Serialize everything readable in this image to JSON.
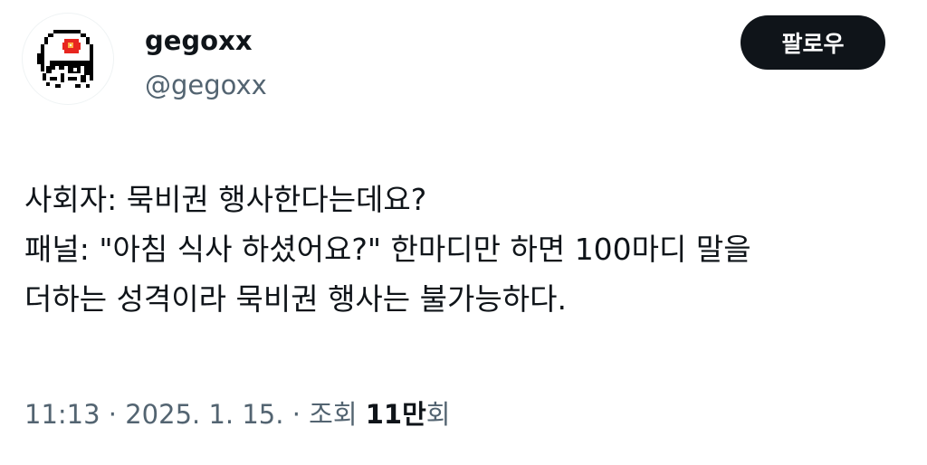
{
  "user": {
    "display_name": "gegoxx",
    "handle": "@gegoxx",
    "avatar_icon": "pixel-ghost-avatar"
  },
  "follow_button": {
    "label": "팔로우"
  },
  "tweet": {
    "lines": [
      "사회자: 묵비권 행사한다는데요?",
      "패널: \"아침 식사 하셨어요?\" 한마디만 하면 100마디 말을",
      "더하는 성격이라 묵비권 행사는 불가능하다."
    ]
  },
  "meta": {
    "time": "11:13",
    "separator1": "·",
    "date": "2025. 1. 15.",
    "separator2": "·",
    "views_label_prefix": "조회",
    "views_count": "11만",
    "views_label_suffix": "회"
  },
  "colors": {
    "text_primary": "#0f1419",
    "text_secondary": "#536471",
    "button_bg": "#0f1419",
    "button_text": "#ffffff",
    "avatar_eye": "#e8261f"
  }
}
